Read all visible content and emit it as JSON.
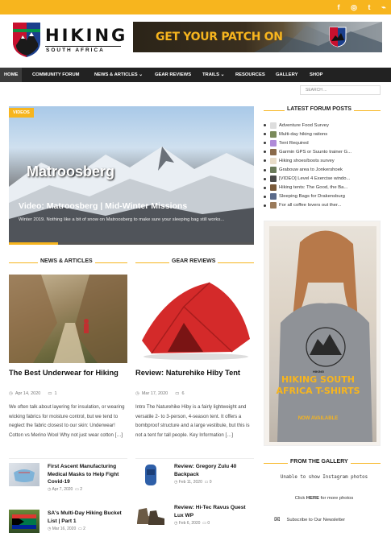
{
  "social": {
    "facebook": "f",
    "instagram": "◎",
    "twitter": "t",
    "rss": "⌁"
  },
  "logo": {
    "name": "HIKING",
    "tagline": "SOUTH AFRICA"
  },
  "banner": {
    "text": "GET YOUR PATCH ON"
  },
  "nav": {
    "items": [
      {
        "label": "HOME",
        "active": true
      },
      {
        "label": "COMMUNITY FORUM"
      },
      {
        "label": "NEWS & ARTICLES ⌄"
      },
      {
        "label": "GEAR REVIEWS"
      },
      {
        "label": "TRAILS ⌄"
      },
      {
        "label": "RESOURCES"
      },
      {
        "label": "GALLERY"
      },
      {
        "label": "SHOP"
      }
    ]
  },
  "search": {
    "placeholder": "SEARCH ..."
  },
  "hero": {
    "tag": "VIDEOS",
    "overlay": "Matroosberg",
    "title": "Video: Matroosberg | Mid-Winter Missions",
    "excerpt": "Winter 2019. Nothing like a bit of snow on Matroosberg to make sure your sleeping bag still works...",
    "slide_progress": 0.2
  },
  "forum": {
    "heading": "LATEST FORUM POSTS",
    "posts": [
      {
        "title": "Adventure Food Survey",
        "avatar": "#ddd"
      },
      {
        "title": "Multi-day hiking rations",
        "avatar": "#7a8a5a"
      },
      {
        "title": "Tent Required",
        "avatar": "#b08bd8"
      },
      {
        "title": "Garmin GPS or Suunto trainer G...",
        "avatar": "#8a6a4a"
      },
      {
        "title": "Hiking shoes/boots survey",
        "avatar": "#e8dcc8"
      },
      {
        "title": "Grabouw area to Jonkershoek",
        "avatar": "#6a7a5a"
      },
      {
        "title": "[VIDEO] Level 4 Exercise windo...",
        "avatar": "#4a4a4a"
      },
      {
        "title": "Hiking tents: The Good, the Ba...",
        "avatar": "#7a5a3a"
      },
      {
        "title": "Sleeping Bags for Drakensburg",
        "avatar": "#5a6a8a"
      },
      {
        "title": "For all coffee lovers out ther...",
        "avatar": "#9a7a5a"
      }
    ]
  },
  "ad": {
    "title": "HIKING SOUTH AFRICA T-SHIRTS",
    "sub": "NOW AVAILABLE",
    "shirt_text": "HIKING"
  },
  "news": {
    "heading": "NEWS & ARTICLES",
    "main": {
      "title": "The Best Underwear for Hiking",
      "date": "Apr 14, 2020",
      "comments": "1",
      "excerpt": "We often talk about layering for insulation, or wearing wicking fabrics for moisture control, but we tend to neglect the fabric closest to our skin: Underwear! Cotton vs Merino Wool Why not just wear cotton […]"
    },
    "small": [
      {
        "title": "First Ascent Manufacturing Medical Masks to Help Fight Covid-19",
        "date": "Apr 7, 2020",
        "comments": "2"
      },
      {
        "title": "SA's Multi-Day Hiking Bucket List | Part 1",
        "date": "Mar 16, 2020",
        "comments": "2"
      }
    ]
  },
  "gear": {
    "heading": "GEAR REVIEWS",
    "main": {
      "title": "Review: Naturehike Hiby Tent",
      "date": "Mar 17, 2020",
      "comments": "6",
      "excerpt": "Intro The Naturehike Hiby is a fairly lightweight and versatile 2- to 3-person, 4-season tent. It offers a bombproof structure and a large vestibule, but this is not a tent for tall people. Key Information […]"
    },
    "small": [
      {
        "title": "Review: Gregory Zulu 40 Backpack",
        "date": "Feb 11, 2020",
        "comments": "0"
      },
      {
        "title": "Review: Hi-Tec Ravus Quest Lux WP",
        "date": "Feb 6, 2020",
        "comments": "0"
      }
    ]
  },
  "gallery": {
    "heading": "FROM THE GALLERY",
    "message": "Unable to show Instagram photos",
    "link_prefix": "Click",
    "link_word": "HERE",
    "link_suffix": "for more photos",
    "newsletter": "Subscribe to Our Newsletter"
  },
  "colors": {
    "accent": "#f7b51e",
    "nav": "#222222",
    "tent": "#d42a2a"
  }
}
